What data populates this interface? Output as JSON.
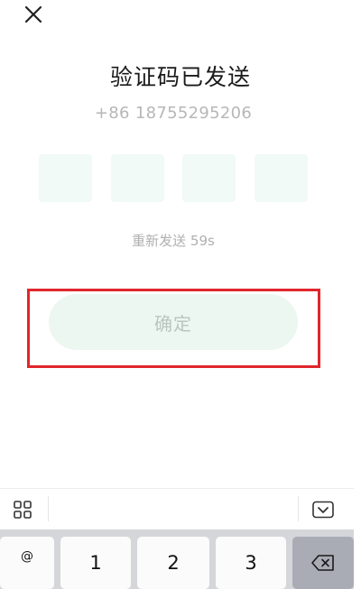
{
  "header": {
    "close_icon": "close-icon"
  },
  "title": "验证码已发送",
  "phone": "+86 18755295206",
  "code_inputs": {
    "count": 4,
    "values": [
      "",
      "",
      "",
      ""
    ]
  },
  "resend": {
    "text": "重新发送 59s"
  },
  "confirm_button": {
    "label": "确定"
  },
  "highlight": {
    "color": "#e0262c"
  },
  "keyboard_toolbar": {
    "grid_icon": "grid-icon",
    "hide_icon": "keyboard-hide-icon"
  },
  "keyboard": {
    "keys": [
      {
        "label": "@"
      },
      {
        "label": "1"
      },
      {
        "label": "2"
      },
      {
        "label": "3"
      }
    ],
    "delete_icon": "backspace-icon"
  },
  "colors": {
    "accent_light": "#ecf7f1",
    "code_box": "#f1faf6",
    "muted_text": "#b0b0b0"
  }
}
